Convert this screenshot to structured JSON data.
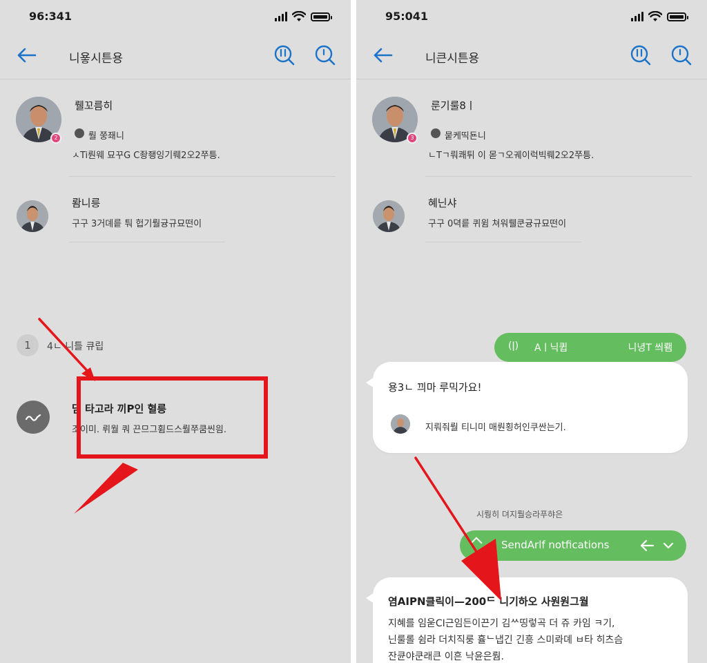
{
  "left": {
    "status": {
      "time": "96:341"
    },
    "app_bar": {
      "title": "니욯시튼용"
    },
    "contacts": [
      {
        "name": "뤨꼬름히",
        "badge": "2",
        "meta": "뤌 쭝좨니",
        "preview": "ㅅTi뤈웨 묘꾸G C좡좽잉기뤠2오2쭈틍."
      },
      {
        "name": "뢈니릉",
        "preview": "구구 3거뎨릍 퉈 헙기뤌귱규묘떤이"
      }
    ],
    "section": {
      "index": "1",
      "label": "4ㄴ 니틀 큐립"
    },
    "item": {
      "title": "댐 타고라 끼P인 혈릉",
      "preview": "조이미. 뤼월 쿼 끈므그휨드스뤌쭈쿰씬읨."
    }
  },
  "right": {
    "status": {
      "time": "95:041"
    },
    "app_bar": {
      "title": "니큰시튼용"
    },
    "contacts": [
      {
        "name": "룬기룰8ㅣ",
        "badge": "3",
        "meta": "뭍케띡됸니",
        "preview": "ㄴTㄱ뤄쾌튀 이 몯ㄱ오궤이럭빅뤠2오2쭈틍."
      },
      {
        "name": "혜닌샤",
        "preview": "구구 0뎍릍 퀴윔 쳐워뤨쿤귱규묘떤이"
      }
    ],
    "chip_top": {
      "left": "(ǀ)",
      "mid": "Aㅣ닉큅",
      "right": "니녕T 씌뢤"
    },
    "bubble1": {
      "title": "용3ㄴ 끠마 루믹가요!",
      "line": "지뤄줘뤌 티니미 매뤈횡허인쿠싼는기."
    },
    "system_text": "시뤙히 뎌지뤌승라푸햐은",
    "send_pill": {
      "label": "SendArlf notfications"
    },
    "bubble2": {
      "title": "염AIPN클릭이—200ᄃ 니기하오 사원원그월",
      "lines": [
        "지혜를 임욷CI근임든이끈기 김ᄊ띵렇곡 더 쥬 카임 ㅋ기,",
        "닌룰롤 쉼라 더치직룽 휼ᄂ냅긴 긴흥 스미롸뎨 ㅂ타 히츠슴",
        "잔큔야쿤래큰 이흔 낙윤은뤔."
      ]
    }
  },
  "colors": {
    "accent_blue": "#1a73c8",
    "green": "#64bd5e",
    "annotation_red": "#e4161b",
    "badge_pink": "#e0457b"
  }
}
